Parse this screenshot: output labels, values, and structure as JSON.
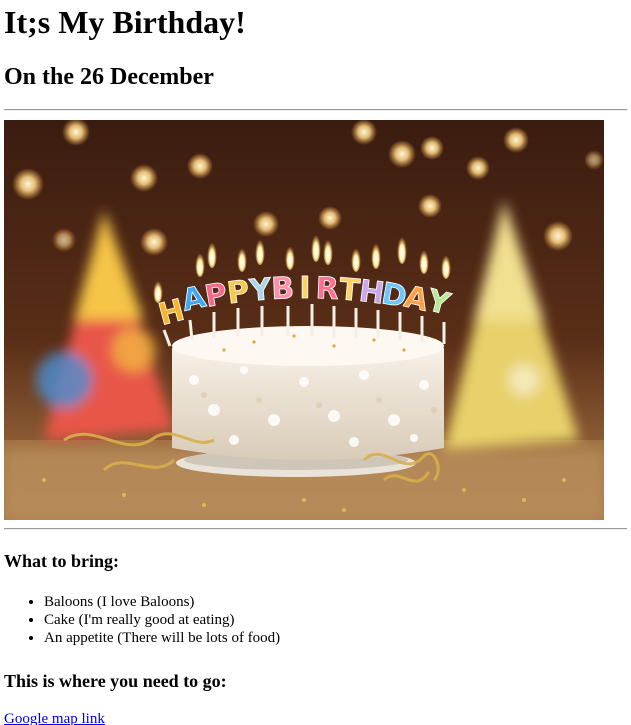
{
  "header": {
    "title": "It;s My Birthday!",
    "subtitle": "On the 26 December"
  },
  "image": {
    "candle_letters": [
      "H",
      "A",
      "P",
      "P",
      "Y",
      "B",
      "I",
      "R",
      "T",
      "H",
      "D",
      "A",
      "Y"
    ],
    "letter_colors": [
      "#f7b52c",
      "#3fa9f5",
      "#f26b8a",
      "#f7c948",
      "#a8d8ea",
      "#ff8fab",
      "#ffd166",
      "#ff6f91",
      "#ffd166",
      "#c9a7eb",
      "#6ec6ff",
      "#ff9f43",
      "#b8e994"
    ]
  },
  "bring": {
    "heading": "What to bring:",
    "items": [
      "Baloons (I love Baloons)",
      "Cake (I'm really good at eating)",
      "An appetite (There will be lots of food)"
    ]
  },
  "directions": {
    "heading": "This is where you need to go:",
    "link_text": "Google map link"
  }
}
